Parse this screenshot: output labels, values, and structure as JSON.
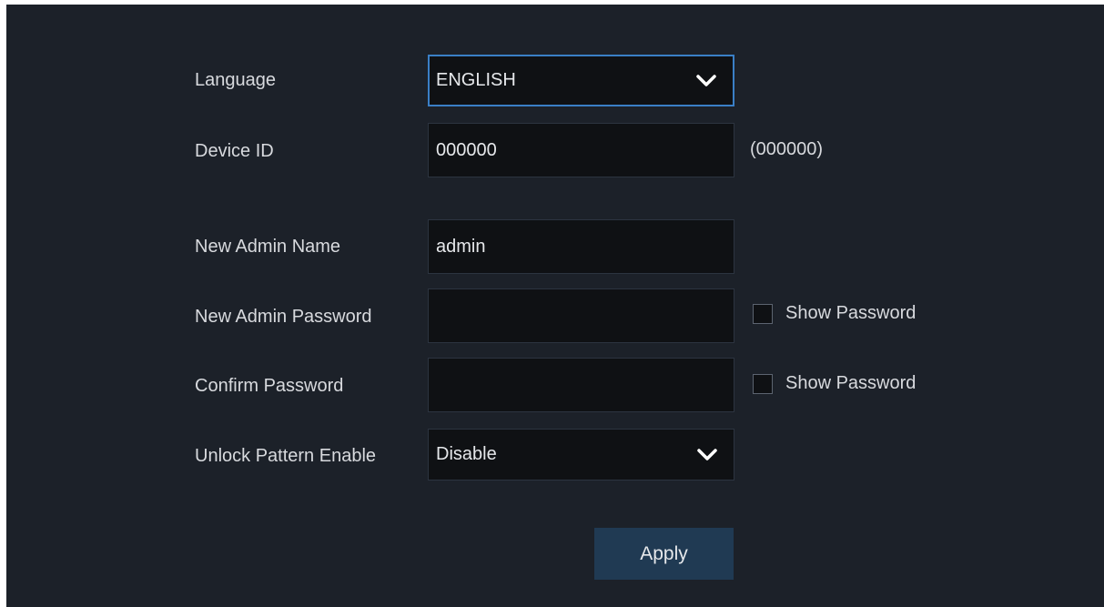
{
  "form": {
    "language": {
      "label": "Language",
      "value": "ENGLISH"
    },
    "device_id": {
      "label": "Device ID",
      "value": "000000",
      "hint": "(000000)"
    },
    "admin_name": {
      "label": "New Admin Name",
      "value": "admin"
    },
    "admin_password": {
      "label": "New Admin Password",
      "value": "",
      "show_label": "Show Password",
      "show_checked": false
    },
    "confirm_password": {
      "label": "Confirm Password",
      "value": "",
      "show_label": "Show Password",
      "show_checked": false
    },
    "unlock_pattern": {
      "label": "Unlock Pattern Enable",
      "value": "Disable"
    }
  },
  "actions": {
    "apply_label": "Apply"
  },
  "icons": {
    "dropdown": "chevron-down-icon"
  },
  "colors": {
    "panel_bg": "#1c2129",
    "field_bg": "#0f1114",
    "focus_border": "#3a7fc6",
    "apply_bg": "#203a53"
  }
}
